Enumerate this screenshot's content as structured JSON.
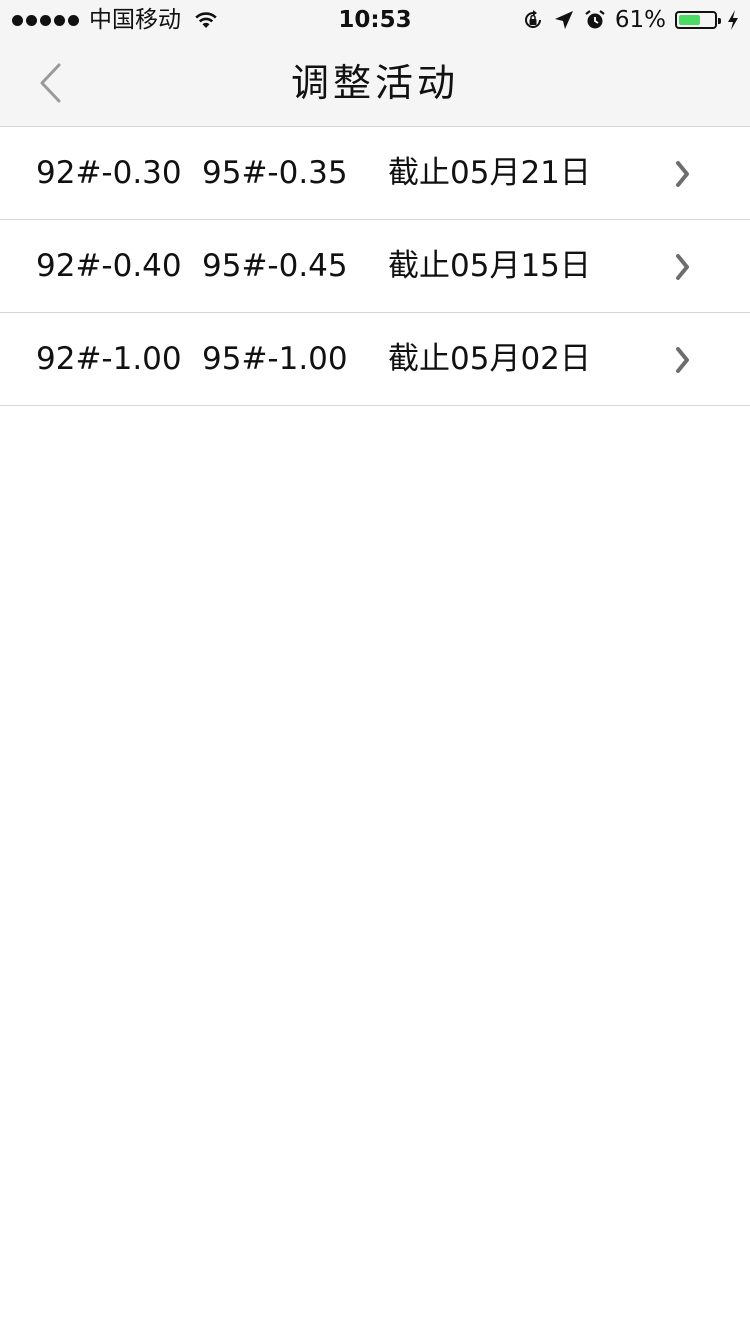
{
  "status_bar": {
    "carrier": "中国移动",
    "time": "10:53",
    "battery_percent": "61%",
    "battery_level": 0.61,
    "icons": [
      "signal-dots",
      "wifi-icon",
      "orientation-lock-icon",
      "location-arrow-icon",
      "alarm-icon",
      "battery-icon",
      "charging-bolt-icon"
    ]
  },
  "nav": {
    "title": "调整活动",
    "back_icon": "chevron-left-icon"
  },
  "activities": [
    {
      "p92": "92#-0.30",
      "p95": "95#-0.35",
      "deadline": "截止05月21日"
    },
    {
      "p92": "92#-0.40",
      "p95": "95#-0.45",
      "deadline": "截止05月15日"
    },
    {
      "p92": "92#-1.00",
      "p95": "95#-1.00",
      "deadline": "截止05月02日"
    }
  ],
  "colors": {
    "bar_background": "#f5f5f5",
    "separator": "#d6d6d6",
    "battery_fill": "#4cd964",
    "chevron": "#8e8e93"
  }
}
